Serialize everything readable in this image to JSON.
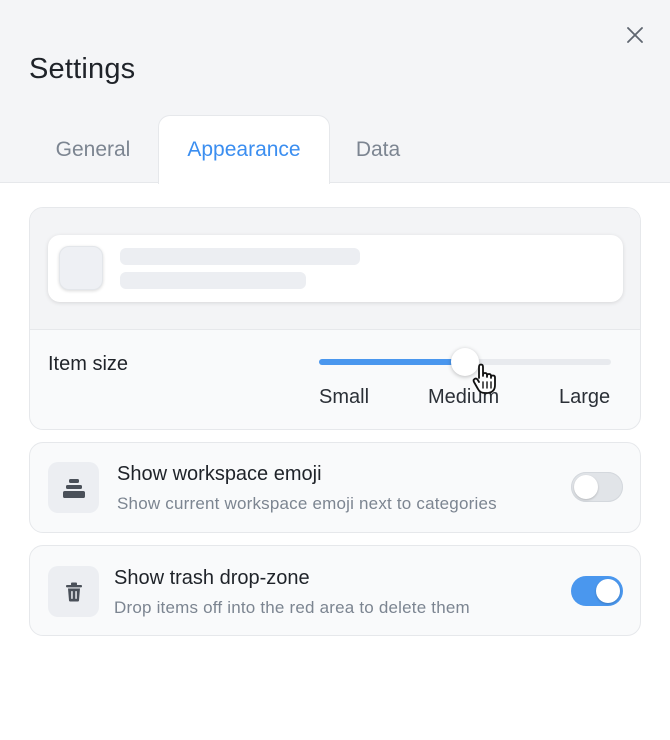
{
  "dialog": {
    "title": "Settings"
  },
  "tabs": [
    {
      "label": "General",
      "active": false
    },
    {
      "label": "Appearance",
      "active": true
    },
    {
      "label": "Data",
      "active": false
    }
  ],
  "item_size": {
    "label": "Item size",
    "options": [
      "Small",
      "Medium",
      "Large"
    ],
    "selected": "Medium",
    "value_fraction": 0.5
  },
  "options": [
    {
      "title": "Show workspace emoji",
      "description": "Show current workspace emoji next to categories",
      "icon": "stack-icon",
      "enabled": false
    },
    {
      "title": "Show trash drop-zone",
      "description": "Drop items off into the red area to delete them",
      "icon": "trash-icon",
      "enabled": true
    }
  ],
  "colors": {
    "accent": "#4a97ee",
    "active_tab_text": "#3b8ef0",
    "header_bg": "#f4f5f7",
    "muted_text": "#7c8591"
  }
}
